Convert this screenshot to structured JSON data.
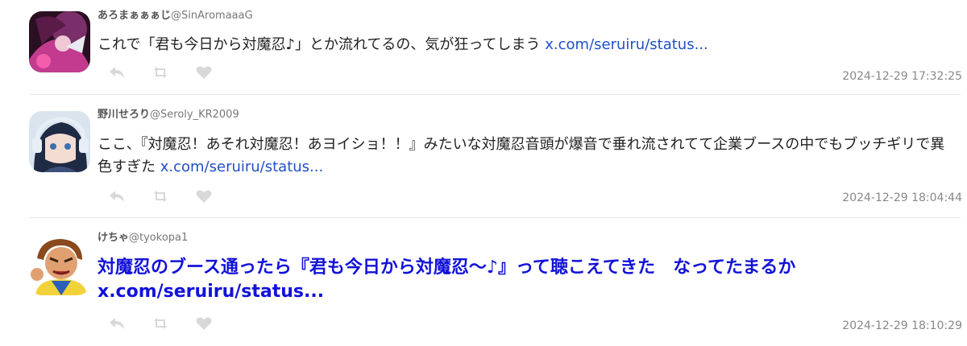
{
  "tweets": [
    {
      "name": "あろまぁぁぁじ",
      "handle": "@SinAromaaaG",
      "text": "これで「君も今日から対魔忍♪」とか流れてるの、気が狂ってしまう",
      "link": "x.com/seruiru/status...",
      "timestamp": "2024-12-29 17:32:25",
      "avatar_icon": "anime-character-avatar"
    },
    {
      "name": "野川せろり",
      "handle": "@Seroly_KR2009",
      "text": "ここ、『対魔忍！あそれ対魔忍！あヨイショ！！』みたいな対魔忍音頭が爆音で垂れ流されてて企業ブースの中でもブッチギリで異色すぎた",
      "link": "x.com/seruiru/status...",
      "timestamp": "2024-12-29 18:04:44",
      "avatar_icon": "anime-girl-headphones-avatar"
    },
    {
      "name": "けちゃ",
      "handle": "@tyokopa1",
      "text": "対魔忍のブース通ったら『君も今日から対魔忍〜♪』って聴こえてきた　なってたまるか",
      "link": "x.com/seruiru/status...",
      "timestamp": "2024-12-29 18:10:29",
      "avatar_icon": "cartoon-character-avatar"
    }
  ],
  "actions": {
    "reply_icon": "reply-icon",
    "retweet_icon": "retweet-icon",
    "like_icon": "heart-icon"
  },
  "colors": {
    "link": "#1f4fc8",
    "highlight_text": "#1212d8",
    "action_icon": "#d8d8d8",
    "timestamp": "#888888"
  }
}
